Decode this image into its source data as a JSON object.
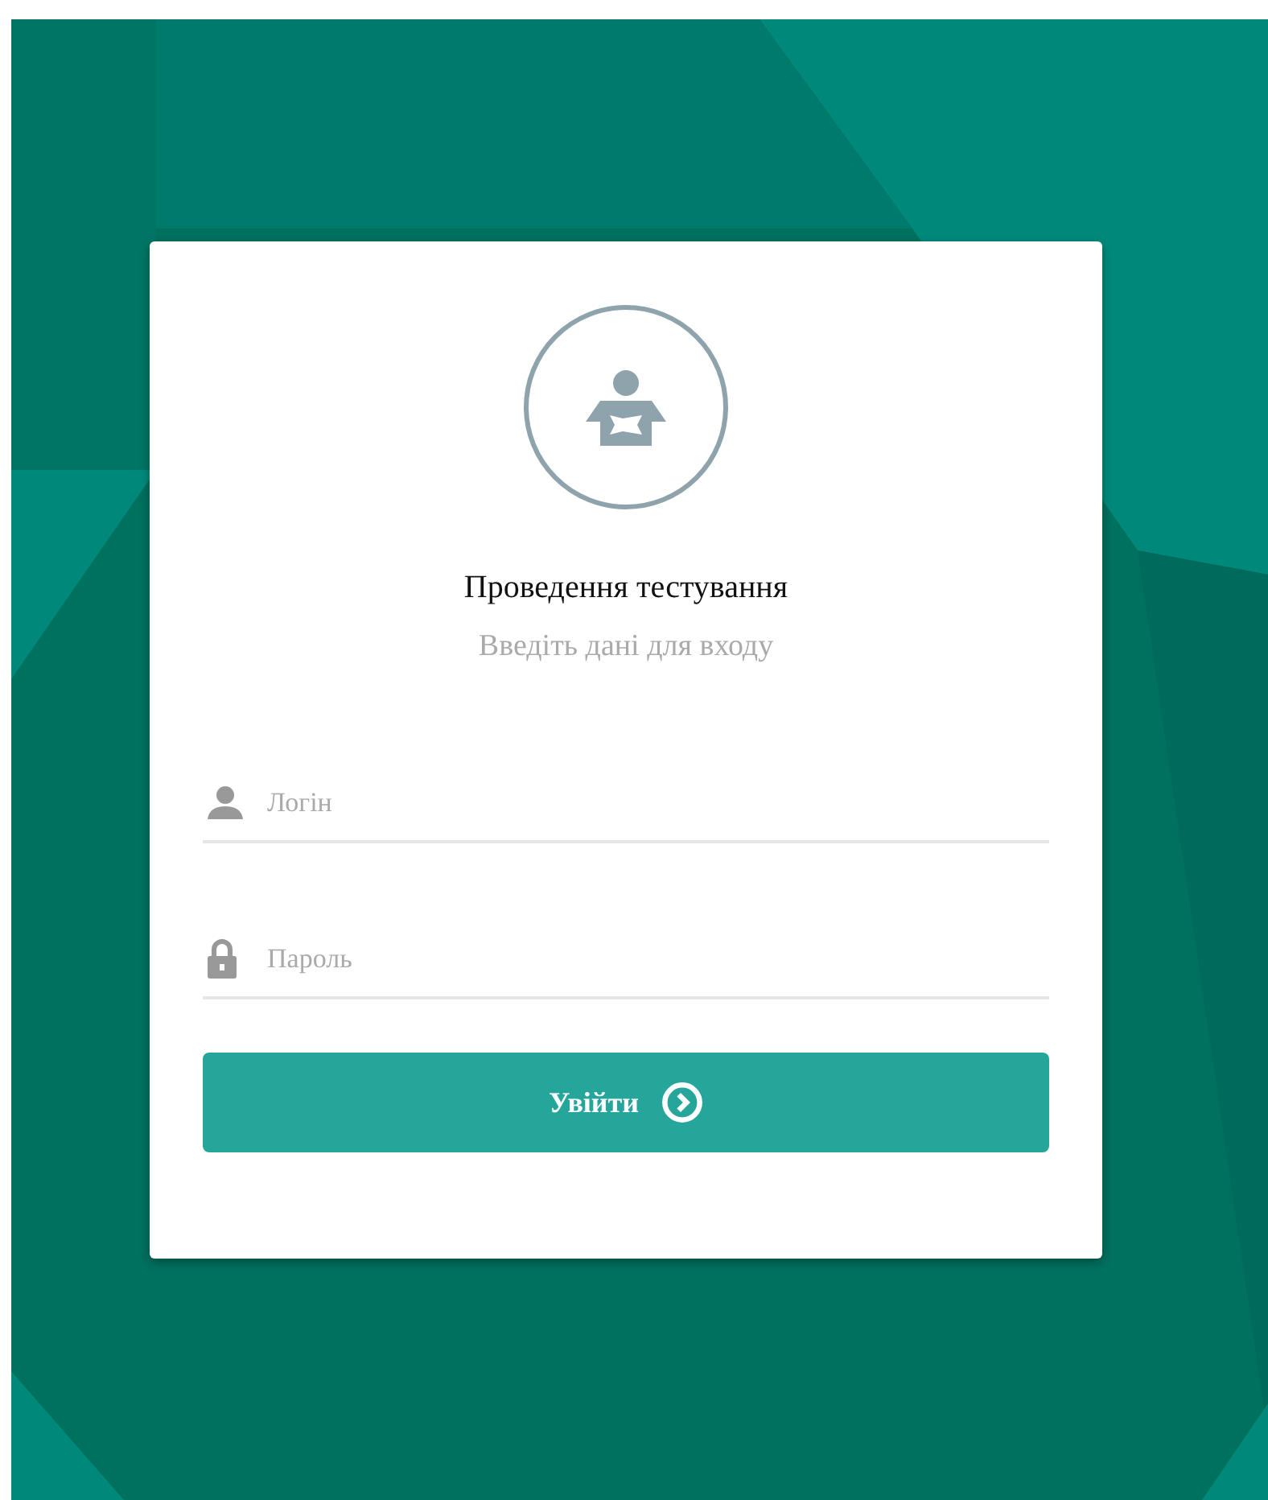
{
  "login_card": {
    "title": "Проведення тестування",
    "subtitle": "Введіть дані для входу",
    "fields": [
      {
        "kind": "user",
        "placeholder": "Логін"
      },
      {
        "kind": "password",
        "placeholder": "Пароль"
      }
    ],
    "submit_button": {
      "label": "Увійти"
    }
  }
}
